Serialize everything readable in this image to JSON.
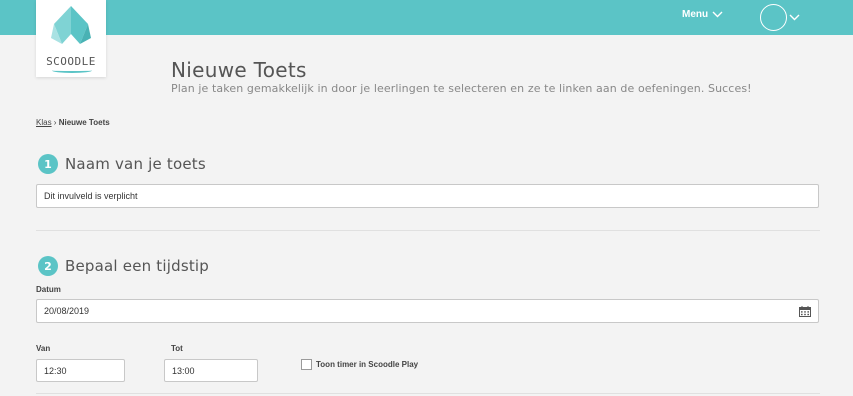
{
  "header": {
    "menu_label": "Menu",
    "logo_text": "SCOODLE",
    "colors": {
      "accent": "#5bc4c6"
    }
  },
  "page": {
    "title": "Nieuwe Toets",
    "subtitle": "Plan je taken gemakkelijk in door je leerlingen te selecteren en ze te linken aan de oefeningen. Succes!"
  },
  "breadcrumb": {
    "link": "Klas",
    "separator": "›",
    "current": "Nieuwe Toets"
  },
  "step1": {
    "number": "1",
    "title": "Naam van je toets",
    "name_value": "Dit invulveld is verplicht"
  },
  "step2": {
    "number": "2",
    "title": "Bepaal een tijdstip",
    "date_label": "Datum",
    "date_value": "20/08/2019",
    "from_label": "Van",
    "from_value": "12:30",
    "to_label": "Tot",
    "to_value": "13:00",
    "timer_label": "Toon timer in Scoodle Play"
  },
  "icons": [
    "logo-icon",
    "chevron-down-icon",
    "avatar-icon",
    "calendar-icon",
    "checkbox-icon"
  ]
}
